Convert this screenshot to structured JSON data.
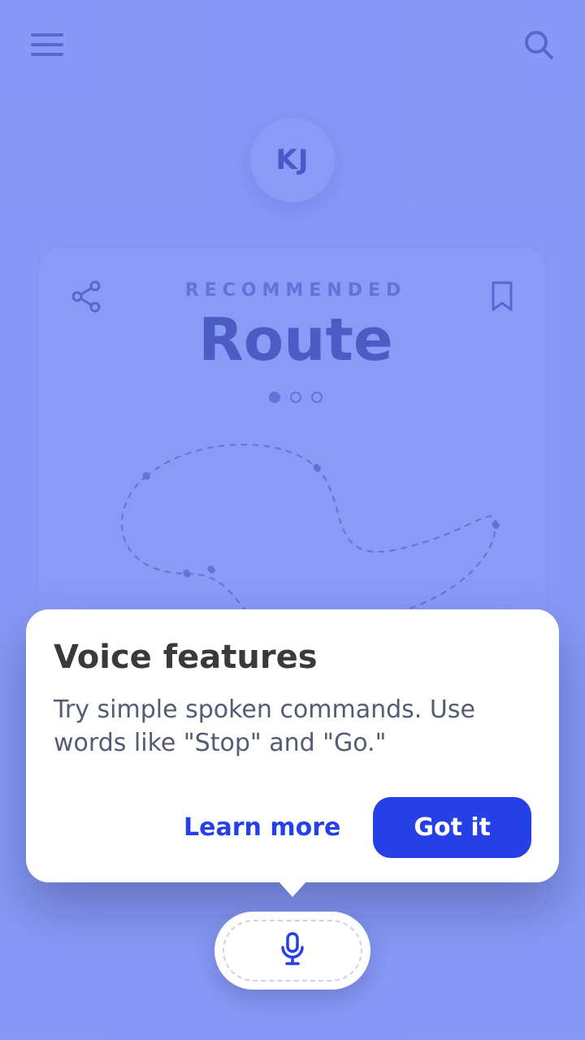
{
  "header": {
    "avatar_initials": "KJ"
  },
  "card": {
    "eyebrow": "RECOMMENDED",
    "title": "Route"
  },
  "popover": {
    "title": "Voice features",
    "body": "Try simple spoken commands. Use words like \"Stop\" and \"Go.\"",
    "learn_more_label": "Learn more",
    "confirm_label": "Got it"
  }
}
